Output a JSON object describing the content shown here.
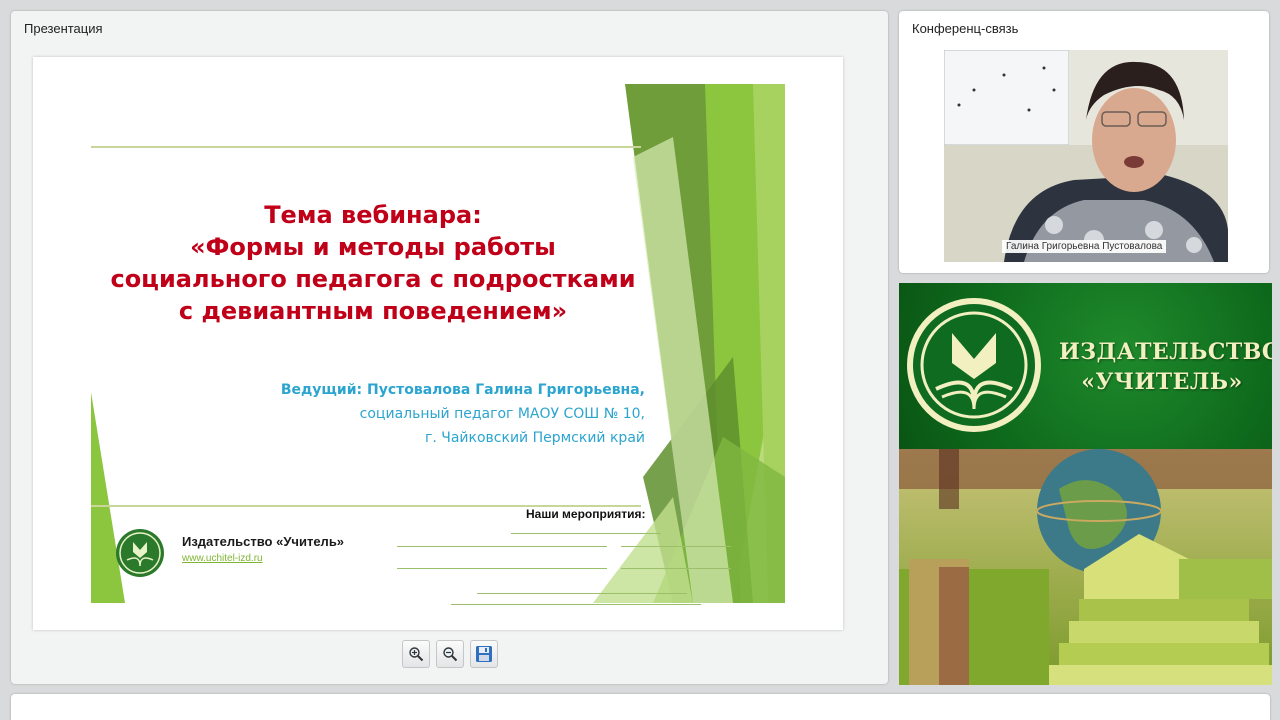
{
  "presentation": {
    "panel_title": "Презентация",
    "slide": {
      "title_lines": [
        "Тема вебинара:",
        "«Формы и методы работы",
        "социального педагога с подростками",
        "с девиантным поведением»"
      ],
      "presenter_name": "Ведущий: Пустовалова Галина Григорьевна,",
      "presenter_role": "социальный педагог МАОУ СОШ  № 10,",
      "presenter_city": "г. Чайковский Пермский край",
      "publisher_name": "Издательство «Учитель»",
      "publisher_url": "www.uchitel-izd.ru",
      "events_heading": "Наши мероприятия:"
    },
    "tools": [
      {
        "icon": "zoom-in-icon"
      },
      {
        "icon": "zoom-out-icon"
      },
      {
        "icon": "save-icon"
      }
    ]
  },
  "conference": {
    "panel_title": "Конференц-связь",
    "participant_name": "Галина Григорьевна Пустовалова"
  },
  "banner": {
    "line1": "ИЗДАТЕЛЬСТВО",
    "line2": "«УЧИТЕЛЬ»"
  },
  "colors": {
    "title_red": "#c00018",
    "presenter_blue": "#2ba5cf",
    "brand_green": "#0e6a1c",
    "accent_lime": "#8cc63f"
  }
}
